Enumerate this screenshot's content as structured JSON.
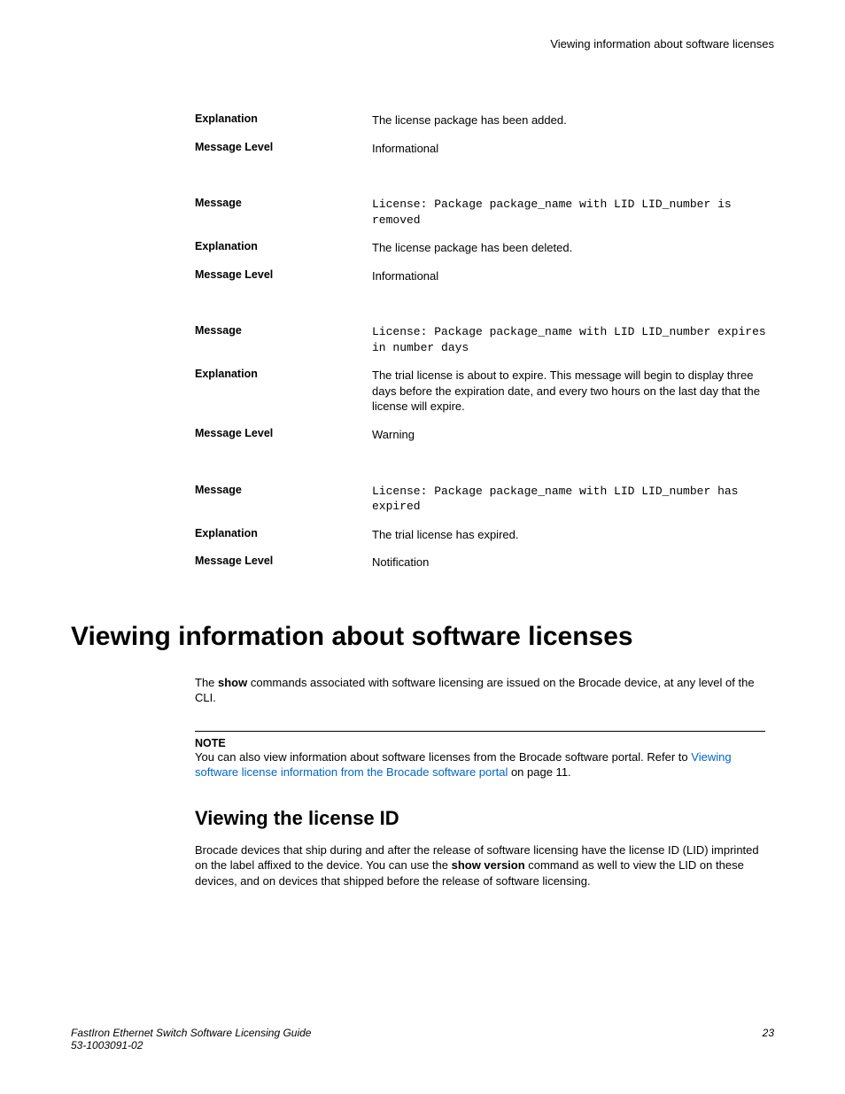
{
  "header": "Viewing information about software licenses",
  "labels": {
    "message": "Message",
    "explanation": "Explanation",
    "level": "Message Level"
  },
  "entries": [
    {
      "explanation": "The license package has been added.",
      "level": "Informational"
    },
    {
      "message": "License: Package package_name with LID LID_number is removed",
      "explanation": "The license package has been deleted.",
      "level": "Informational"
    },
    {
      "message": "License: Package package_name with LID LID_number expires in number days",
      "explanation": "The trial license is about to expire. This message will begin to display three days before the expiration date, and every two hours on the last day that the license will expire.",
      "level": "Warning"
    },
    {
      "message": "License: Package package_name with LID LID_number has expired",
      "explanation": "The trial license has expired.",
      "level": "Notification"
    }
  ],
  "section": {
    "title": "Viewing information about software licenses",
    "intro_pre": "The ",
    "intro_bold": "show",
    "intro_post": " commands associated with software licensing are issued on the Brocade device, at any level of the CLI.",
    "note_label": "NOTE",
    "note_pre": "You can also view information about software licenses from the Brocade software portal. Refer to ",
    "note_link": "Viewing software license information from the Brocade software portal",
    "note_post": " on page 11."
  },
  "subsection": {
    "title": "Viewing the license ID",
    "para_pre": "Brocade devices that ship during and after the release of software licensing have the license ID (LID) imprinted on the label affixed to the device. You can use the ",
    "para_bold": "show version",
    "para_post": " command as well to view the LID on these devices, and on devices that shipped before the release of software licensing."
  },
  "footer": {
    "doc_title": "FastIron Ethernet Switch Software Licensing Guide",
    "doc_number": "53-1003091-02",
    "page_number": "23"
  }
}
